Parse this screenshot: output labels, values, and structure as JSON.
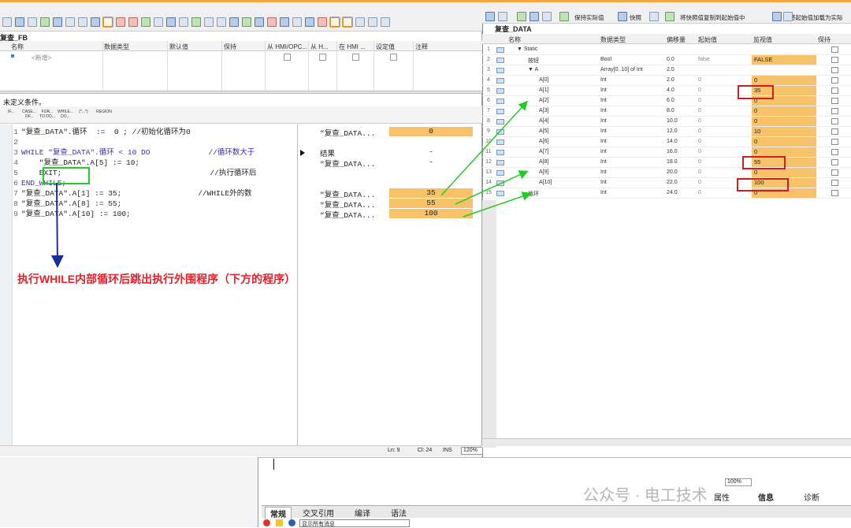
{
  "left": {
    "fb_title": "复查_FB",
    "iface_columns": [
      "名称",
      "数据类型",
      "默认值",
      "保持",
      "从 HMI/OPC...",
      "从 H...",
      "在 HMI ...",
      "设定值",
      "注释"
    ],
    "new_row_label": "<新增>",
    "condition_label": "未定义条件。",
    "instructions": [
      "IF...",
      "CASE... OF...",
      "FOR... TO DO...",
      "WHILE... DO...",
      "(*...*)",
      "REGION"
    ],
    "code_lines": [
      {
        "num": "1",
        "text": "\"复查_DATA\".循环  :=  0 ; //初始化循环为0"
      },
      {
        "num": "2",
        "text": ""
      },
      {
        "num": "3",
        "text": "WHILE \"复查_DATA\".循环 < 10 DO             //循环数大于"
      },
      {
        "num": "4",
        "text": "    \"复查_DATA\".A[5] := 10;"
      },
      {
        "num": "5",
        "text": "    EXIT;                                 //执行循环后"
      },
      {
        "num": "6",
        "text": "END_WHILE;"
      },
      {
        "num": "7",
        "text": "\"复查_DATA\".A[1] := 35;                 //WHILE外的数"
      },
      {
        "num": "8",
        "text": "\"复查_DATA\".A[8] := 55;"
      },
      {
        "num": "9",
        "text": "\"复查_DATA\".A[10] := 100;"
      }
    ],
    "monitor": [
      {
        "label": "\"复查_DATA...",
        "value": "0",
        "orange": true
      },
      {
        "label": "",
        "value": "",
        "orange": false
      },
      {
        "label": "结果",
        "value": "-",
        "orange": false
      },
      {
        "label": "\"复查_DATA...",
        "value": "-",
        "orange": false
      },
      {
        "label": "",
        "value": "",
        "orange": false
      },
      {
        "label": "",
        "value": "",
        "orange": false
      },
      {
        "label": "\"复查_DATA...",
        "value": "35",
        "orange": true
      },
      {
        "label": "\"复查_DATA...",
        "value": "55",
        "orange": true
      },
      {
        "label": "\"复查_DATA...",
        "value": "100",
        "orange": true
      }
    ],
    "status": {
      "ln": "Ln: 9",
      "cl": "Cl: 24",
      "ins": "INS",
      "zoom": "120%"
    },
    "annotation": "执行WHILE内部循环后跳出执行外围程序（下方的程序）"
  },
  "right": {
    "toolbar_labels": [
      "保持实际值",
      "快照",
      "将快照值复制到起始值中",
      "将起始值加载为实际"
    ],
    "db_title": "复查_DATA",
    "columns": [
      "名称",
      "数据类型",
      "偏移量",
      "起始值",
      "监视值",
      "保持"
    ],
    "rows": [
      {
        "num": "1",
        "name": "▼ Static",
        "type": "",
        "offset": "",
        "start": "",
        "mon": "",
        "indent": 0,
        "has_mon": false
      },
      {
        "num": "2",
        "name": "按钮",
        "type": "Bool",
        "offset": "0.0",
        "start": "false",
        "mon": "FALSE",
        "indent": 1,
        "has_mon": true
      },
      {
        "num": "3",
        "name": "▼ A",
        "type": "Array[0..10] of Int",
        "offset": "2.0",
        "start": "",
        "mon": "",
        "indent": 1,
        "has_mon": false
      },
      {
        "num": "4",
        "name": "A[0]",
        "type": "Int",
        "offset": "2.0",
        "start": "0",
        "mon": "0",
        "indent": 2,
        "has_mon": true
      },
      {
        "num": "5",
        "name": "A[1]",
        "type": "Int",
        "offset": "4.0",
        "start": "0",
        "mon": "35",
        "indent": 2,
        "has_mon": true
      },
      {
        "num": "6",
        "name": "A[2]",
        "type": "Int",
        "offset": "6.0",
        "start": "0",
        "mon": "0",
        "indent": 2,
        "has_mon": true
      },
      {
        "num": "7",
        "name": "A[3]",
        "type": "Int",
        "offset": "8.0",
        "start": "0",
        "mon": "0",
        "indent": 2,
        "has_mon": true
      },
      {
        "num": "8",
        "name": "A[4]",
        "type": "Int",
        "offset": "10.0",
        "start": "0",
        "mon": "0",
        "indent": 2,
        "has_mon": true
      },
      {
        "num": "9",
        "name": "A[5]",
        "type": "Int",
        "offset": "12.0",
        "start": "0",
        "mon": "10",
        "indent": 2,
        "has_mon": true
      },
      {
        "num": "10",
        "name": "A[6]",
        "type": "Int",
        "offset": "14.0",
        "start": "0",
        "mon": "0",
        "indent": 2,
        "has_mon": true
      },
      {
        "num": "11",
        "name": "A[7]",
        "type": "Int",
        "offset": "16.0",
        "start": "0",
        "mon": "0",
        "indent": 2,
        "has_mon": true
      },
      {
        "num": "12",
        "name": "A[8]",
        "type": "Int",
        "offset": "18.0",
        "start": "0",
        "mon": "55",
        "indent": 2,
        "has_mon": true
      },
      {
        "num": "13",
        "name": "A[9]",
        "type": "Int",
        "offset": "20.0",
        "start": "0",
        "mon": "0",
        "indent": 2,
        "has_mon": true
      },
      {
        "num": "14",
        "name": "A[10]",
        "type": "Int",
        "offset": "22.0",
        "start": "0",
        "mon": "100",
        "indent": 2,
        "has_mon": true
      },
      {
        "num": "15",
        "name": "循环",
        "type": "Int",
        "offset": "24.0",
        "start": "0",
        "mon": "0",
        "indent": 1,
        "has_mon": true
      }
    ]
  },
  "bottom": {
    "tabs": [
      "常规",
      "交叉引用",
      "编译",
      "语法"
    ],
    "props_tabs": [
      "属性",
      "信息",
      "诊断"
    ],
    "filter": "显示所有消息",
    "zoom": "100%",
    "watermark": "公众号 · 电工技术"
  },
  "colors": {
    "monitor_orange": "#f7c26a",
    "annotation_red": "#e0202a",
    "arrow_green": "#22cc22",
    "arrow_blue": "#1a2f9c",
    "box_red": "#cc1f1f",
    "exit_box_green": "#22cc22"
  }
}
